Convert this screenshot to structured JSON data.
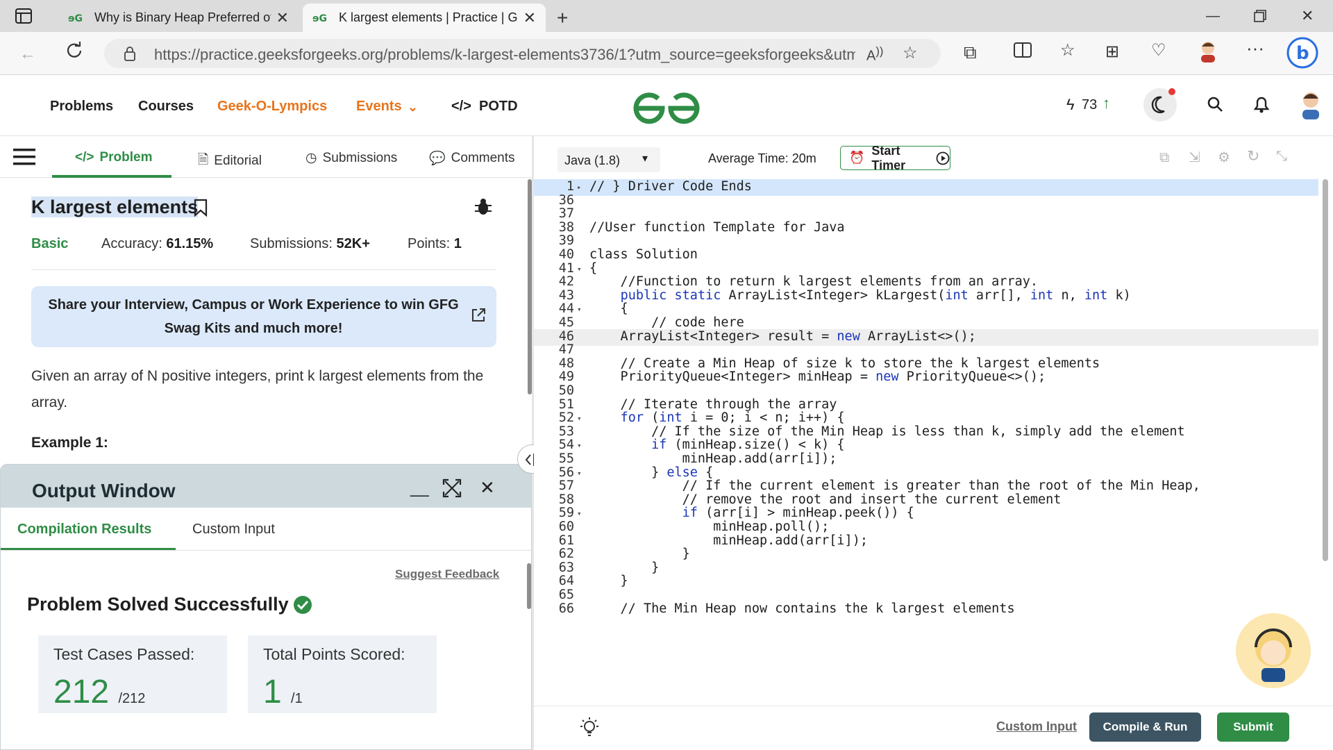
{
  "browser": {
    "tabs": [
      {
        "title": "Why is Binary Heap Preferred over"
      },
      {
        "title": "K largest elements | Practice | GeeksforGeeks"
      }
    ],
    "url_domain": "https://practice.geeksforgeeks.org",
    "url_path": "/problems/k-largest-elements3736/1?utm_source=geeksforgeeks&utm_..."
  },
  "site_nav": {
    "items": [
      "Problems",
      "Courses",
      "Geek-O-Lympics",
      "Events",
      "POTD"
    ],
    "streak": "73"
  },
  "problem_tabs": [
    "Problem",
    "Editorial",
    "Submissions",
    "Comments"
  ],
  "problem": {
    "title": "K largest elements",
    "difficulty": "Basic",
    "accuracy_label": "Accuracy:",
    "accuracy": "61.15%",
    "submissions_label": "Submissions:",
    "submissions": "52K+",
    "points_label": "Points:",
    "points": "1",
    "share_banner": "Share your Interview, Campus or Work Experience to win GFG Swag Kits and much more!",
    "description": "Given an array of N positive integers, print k largest elements from the array.",
    "example_heading": "Example 1:"
  },
  "output": {
    "title": "Output Window",
    "tabs": [
      "Compilation Results",
      "Custom Input"
    ],
    "suggest": "Suggest Feedback",
    "status": "Problem Solved Successfully",
    "tests_label": "Test Cases Passed:",
    "tests_value": "212",
    "tests_total": "/212",
    "points_label": "Total Points Scored:",
    "points_value": "1",
    "points_total": "/1"
  },
  "editor": {
    "language": "Java (1.8)",
    "avg_time": "Average Time: 20m",
    "timer": "Start Timer",
    "lines": [
      {
        "n": "1",
        "t": "// } Driver Code Ends"
      },
      {
        "n": "36",
        "t": ""
      },
      {
        "n": "37",
        "t": ""
      },
      {
        "n": "38",
        "t": "//User function Template for Java"
      },
      {
        "n": "39",
        "t": ""
      },
      {
        "n": "40",
        "t": "class Solution"
      },
      {
        "n": "41",
        "t": "{"
      },
      {
        "n": "42",
        "t": "    //Function to return k largest elements from an array."
      },
      {
        "n": "43",
        "t": "    public static ArrayList<Integer> kLargest(int arr[], int n, int k)"
      },
      {
        "n": "44",
        "t": "    {"
      },
      {
        "n": "45",
        "t": "        // code here"
      },
      {
        "n": "46",
        "t": "    ArrayList<Integer> result = new ArrayList<>();"
      },
      {
        "n": "47",
        "t": ""
      },
      {
        "n": "48",
        "t": "    // Create a Min Heap of size k to store the k largest elements"
      },
      {
        "n": "49",
        "t": "    PriorityQueue<Integer> minHeap = new PriorityQueue<>();"
      },
      {
        "n": "50",
        "t": ""
      },
      {
        "n": "51",
        "t": "    // Iterate through the array"
      },
      {
        "n": "52",
        "t": "    for (int i = 0; i < n; i++) {"
      },
      {
        "n": "53",
        "t": "        // If the size of the Min Heap is less than k, simply add the element"
      },
      {
        "n": "54",
        "t": "        if (minHeap.size() < k) {"
      },
      {
        "n": "55",
        "t": "            minHeap.add(arr[i]);"
      },
      {
        "n": "56",
        "t": "        } else {"
      },
      {
        "n": "57",
        "t": "            // If the current element is greater than the root of the Min Heap,"
      },
      {
        "n": "58",
        "t": "            // remove the root and insert the current element"
      },
      {
        "n": "59",
        "t": "            if (arr[i] > minHeap.peek()) {"
      },
      {
        "n": "60",
        "t": "                minHeap.poll();"
      },
      {
        "n": "61",
        "t": "                minHeap.add(arr[i]);"
      },
      {
        "n": "62",
        "t": "            }"
      },
      {
        "n": "63",
        "t": "        }"
      },
      {
        "n": "64",
        "t": "    }"
      },
      {
        "n": "65",
        "t": ""
      },
      {
        "n": "66",
        "t": "    // The Min Heap now contains the k largest elements"
      }
    ],
    "custom_input": "Custom Input",
    "compile_run": "Compile & Run",
    "submit": "Submit"
  },
  "colors": {
    "brand_green": "#2f8d46",
    "accent_orange": "#e8741c",
    "run_button": "#3d5563"
  }
}
